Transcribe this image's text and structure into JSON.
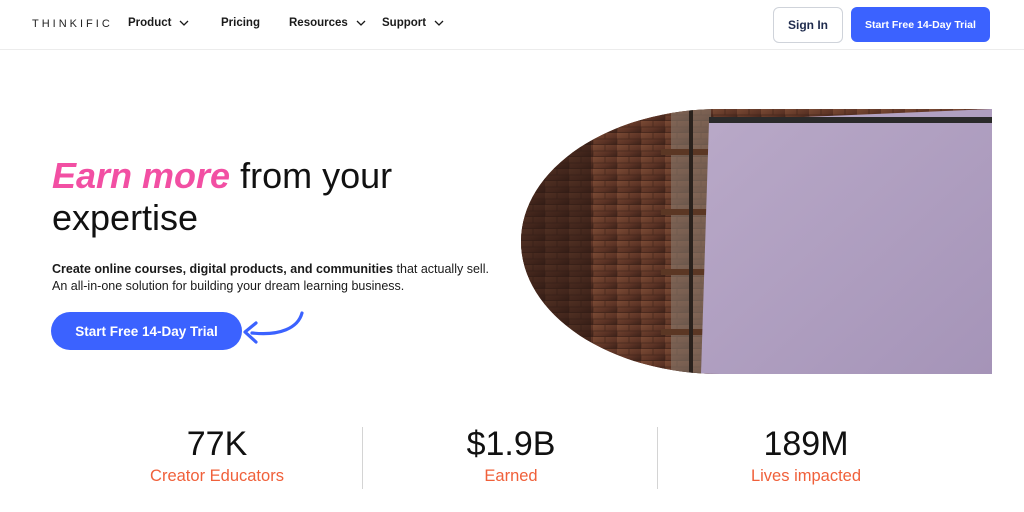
{
  "header": {
    "logo": "THINKIFIC",
    "nav": [
      {
        "label": "Product",
        "has_dropdown": true
      },
      {
        "label": "Pricing",
        "has_dropdown": false
      },
      {
        "label": "Resources",
        "has_dropdown": true
      },
      {
        "label": "Support",
        "has_dropdown": true
      }
    ],
    "sign_in_label": "Sign In",
    "trial_label": "Start Free 14-Day Trial"
  },
  "hero": {
    "headline_accent": "Earn more",
    "headline_rest": "from your expertise",
    "subtext_bold": "Create online courses, digital products, and communities",
    "subtext_rest": "that actually sell. An all-in-one solution for building your dream learning business.",
    "cta_label": "Start Free 14-Day Trial"
  },
  "stats": [
    {
      "value": "77K",
      "label": "Creator Educators"
    },
    {
      "value": "$1.9B",
      "label": "Earned"
    },
    {
      "value": "189M",
      "label": "Lives impacted"
    }
  ],
  "colors": {
    "primary": "#3b62ff",
    "accent_pink": "#f24fa3",
    "stat_orange": "#f0603a"
  },
  "icons": {
    "nav_dropdown": "chevron-down-icon",
    "cta_pointer": "curved-arrow-icon"
  }
}
